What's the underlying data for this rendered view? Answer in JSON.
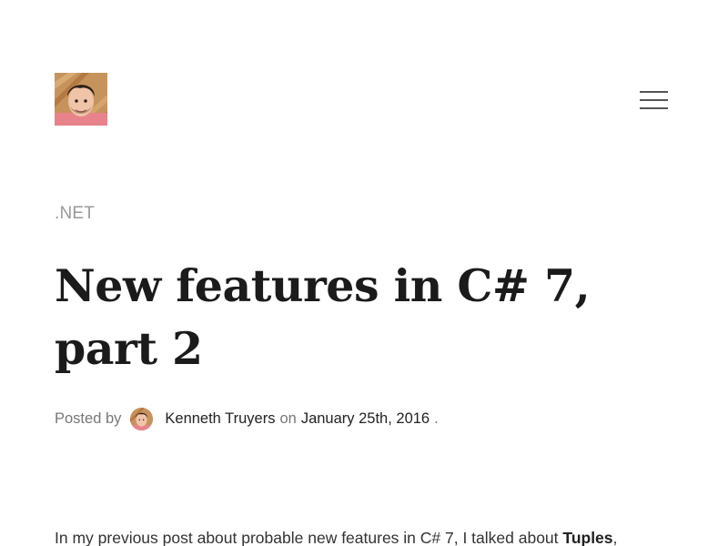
{
  "header": {
    "avatar_icon": "author-portrait-icon",
    "menu_icon": "hamburger-menu-icon"
  },
  "post": {
    "category": ".NET",
    "title": "New features in C# 7, part 2",
    "meta": {
      "posted_by_label": "Posted by",
      "author_name": "Kenneth Truyers",
      "on_label": "on",
      "date": "January 25th, 2016",
      "trailing": "."
    },
    "intro": {
      "text": "In my previous post about probable new features in C# 7, I talked about",
      "highlight": "Tuples",
      "after": ","
    }
  },
  "colors": {
    "title": "#1b1b1b",
    "muted": "#9a9a9a",
    "meta_muted": "#777777",
    "body_text": "#333333",
    "avatar_bg": "#c18751"
  }
}
